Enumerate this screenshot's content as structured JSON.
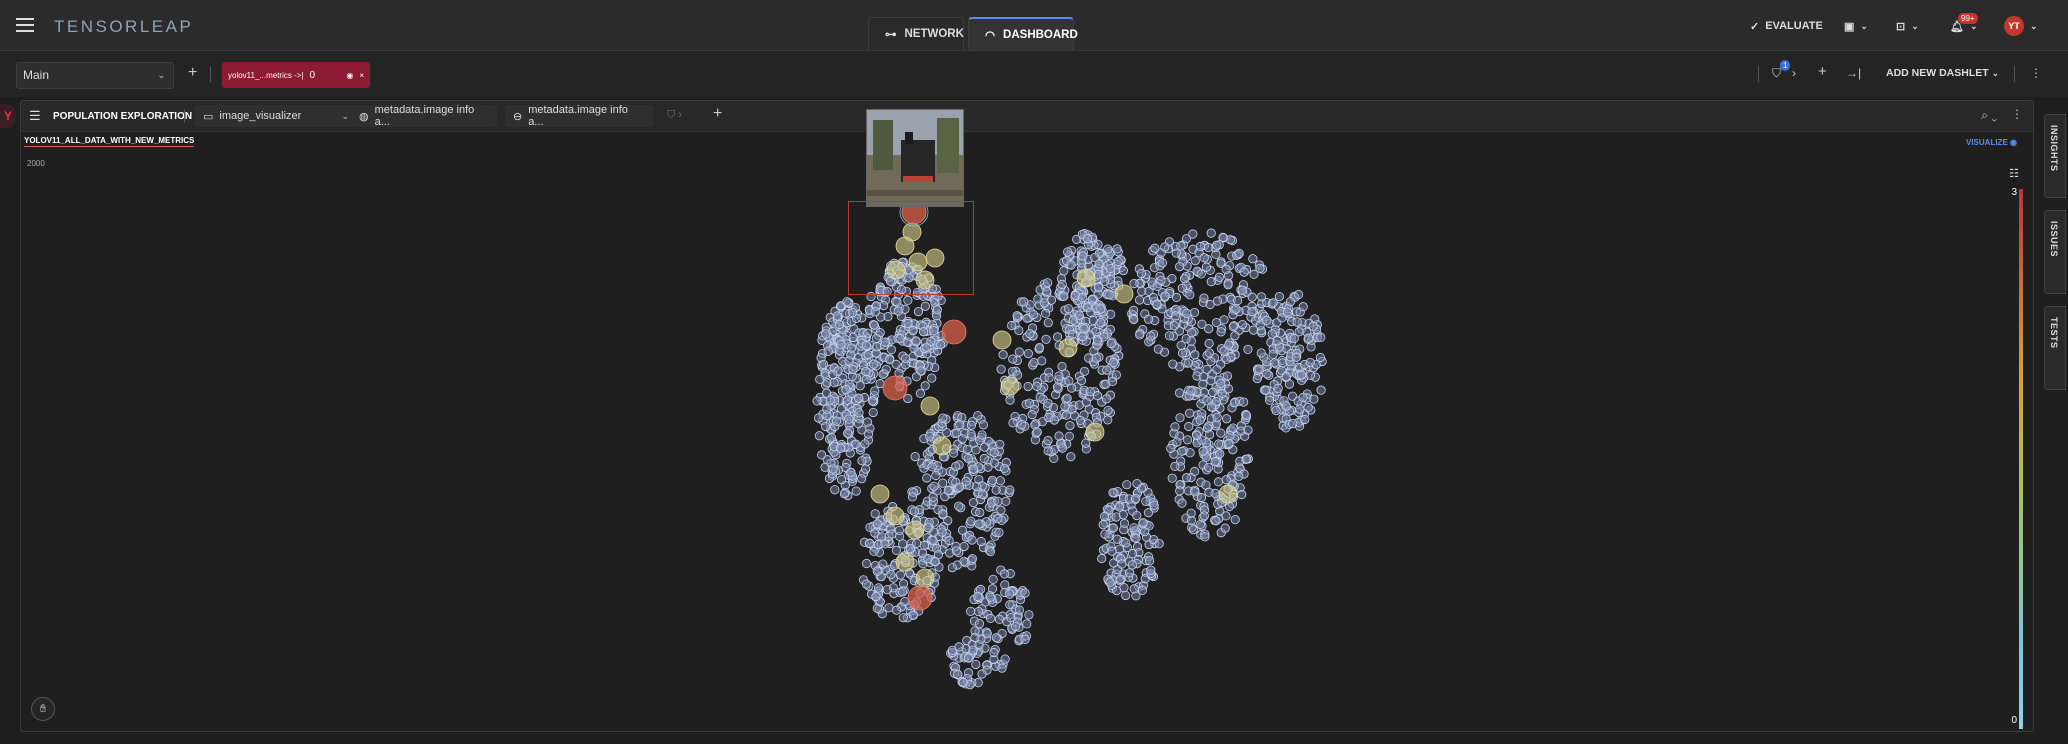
{
  "app": {
    "logo": "TENSORLEAP"
  },
  "topnav": {
    "network": "NETWORK",
    "dashboard": "DASHBOARD"
  },
  "topright": {
    "evaluate": "EVALUATE",
    "notifications_badge": "99+",
    "avatar": "YT"
  },
  "toolbar": {
    "main_select": "Main",
    "filter_chip_label": "yolov11_...metrics ->|",
    "filter_chip_value": "0",
    "filter_count_badge": "1",
    "add_dashlet": "ADD NEW DASHLET"
  },
  "panel": {
    "title": "POPULATION EXPLORATION",
    "chip1": "image_visualizer",
    "chip2": "metadata.image info a...",
    "chip3": "metadata.image info a...",
    "subtitle": "YOLOV11_ALL_DATA_WITH_NEW_METRICS",
    "visualize": "VISUALIZE",
    "axis_label": "2000",
    "scale_max": "3",
    "scale_min": "0"
  },
  "sidetabs": {
    "insights": "INSIGHTS",
    "issues": "ISSUES",
    "tests": "TESTS"
  },
  "colors": {
    "accent": "#5b8def",
    "filter_chip": "#8b1a32",
    "point": "#b9c6e6",
    "highlight_yellow": "#d8d08a",
    "highlight_red": "#d9604a"
  }
}
